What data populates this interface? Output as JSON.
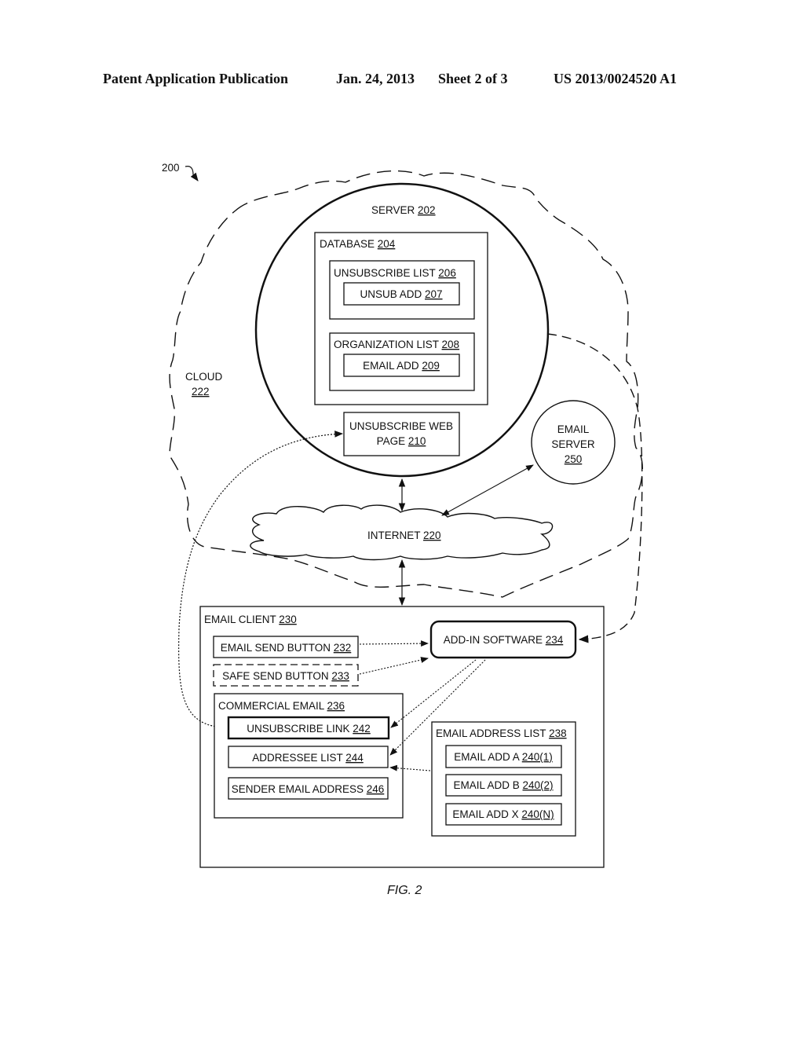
{
  "header": {
    "publication": "Patent Application Publication",
    "date": "Jan. 24, 2013",
    "sheet": "Sheet 2 of 3",
    "number": "US 2013/0024520 A1"
  },
  "diagram": {
    "ref": "200",
    "cloud": {
      "label": "CLOUD",
      "ref": "222"
    },
    "server": {
      "label": "SERVER ",
      "ref": "202"
    },
    "database": {
      "label": "DATABASE ",
      "ref": "204"
    },
    "unsubscribe_list": {
      "label": "UNSUBSCRIBE LIST ",
      "ref": "206"
    },
    "unsub_add": {
      "label": "UNSUB ADD ",
      "ref": "207"
    },
    "organization_list": {
      "label": "ORGANIZATION LIST ",
      "ref": "208"
    },
    "email_add": {
      "label": "EMAIL ADD ",
      "ref": "209"
    },
    "unsubscribe_web_page": {
      "label_line1": "UNSUBSCRIBE WEB",
      "label_line2": "PAGE ",
      "ref": "210"
    },
    "email_server": {
      "label_line1": "EMAIL",
      "label_line2": "SERVER",
      "ref": "250"
    },
    "internet": {
      "label": "INTERNET ",
      "ref": "220"
    },
    "email_client": {
      "label": "EMAIL CLIENT ",
      "ref": "230"
    },
    "email_send_button": {
      "label": "EMAIL SEND BUTTON ",
      "ref": "232"
    },
    "safe_send_button": {
      "label": "SAFE SEND BUTTON ",
      "ref": "233"
    },
    "add_in_software": {
      "label": "ADD-IN SOFTWARE ",
      "ref": "234"
    },
    "commercial_email": {
      "label": "COMMERCIAL EMAIL ",
      "ref": "236"
    },
    "unsubscribe_link": {
      "label": "UNSUBSCRIBE LINK ",
      "ref": "242"
    },
    "addressee_list": {
      "label": "ADDRESSEE LIST ",
      "ref": "244"
    },
    "sender_email_address": {
      "label": "SENDER EMAIL ADDRESS ",
      "ref": "246"
    },
    "email_address_list": {
      "label": "EMAIL ADDRESS LIST ",
      "ref": "238"
    },
    "email_addresses": [
      {
        "label": "EMAIL ADD A ",
        "ref": "240(1)"
      },
      {
        "label": "EMAIL ADD B ",
        "ref": "240(2)"
      },
      {
        "label": "EMAIL ADD X ",
        "ref": "240(N)"
      }
    ],
    "figure_label": "FIG. 2"
  }
}
